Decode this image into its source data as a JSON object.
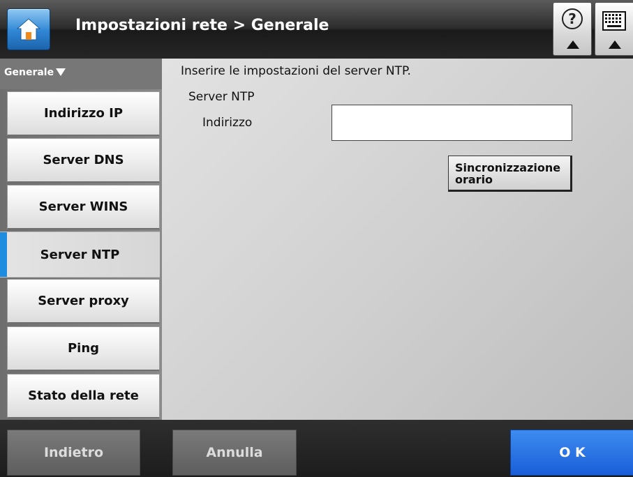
{
  "header": {
    "title": "Impostazioni rete > Generale",
    "home_icon": "home-icon",
    "help_icon": "help-icon",
    "keyboard_icon": "keyboard-icon"
  },
  "sidebar": {
    "section_label": "Generale",
    "items": [
      {
        "label": "Indirizzo IP"
      },
      {
        "label": "Server DNS"
      },
      {
        "label": "Server WINS"
      },
      {
        "label": "Server NTP"
      },
      {
        "label": "Server proxy"
      },
      {
        "label": "Ping"
      },
      {
        "label": "Stato della rete"
      }
    ],
    "active_index": 3
  },
  "main": {
    "instruction": "Inserire le impostazioni del server NTP.",
    "group_label": "Server NTP",
    "address_label": "Indirizzo",
    "address_value": "",
    "sync_button": "Sincronizzazione orario"
  },
  "footer": {
    "back": "Indietro",
    "cancel": "Annulla",
    "ok": "O K"
  },
  "colors": {
    "accent": "#1e8de0",
    "ok_button": "#1a5ed8",
    "header_bg": "#2c2c2c"
  }
}
